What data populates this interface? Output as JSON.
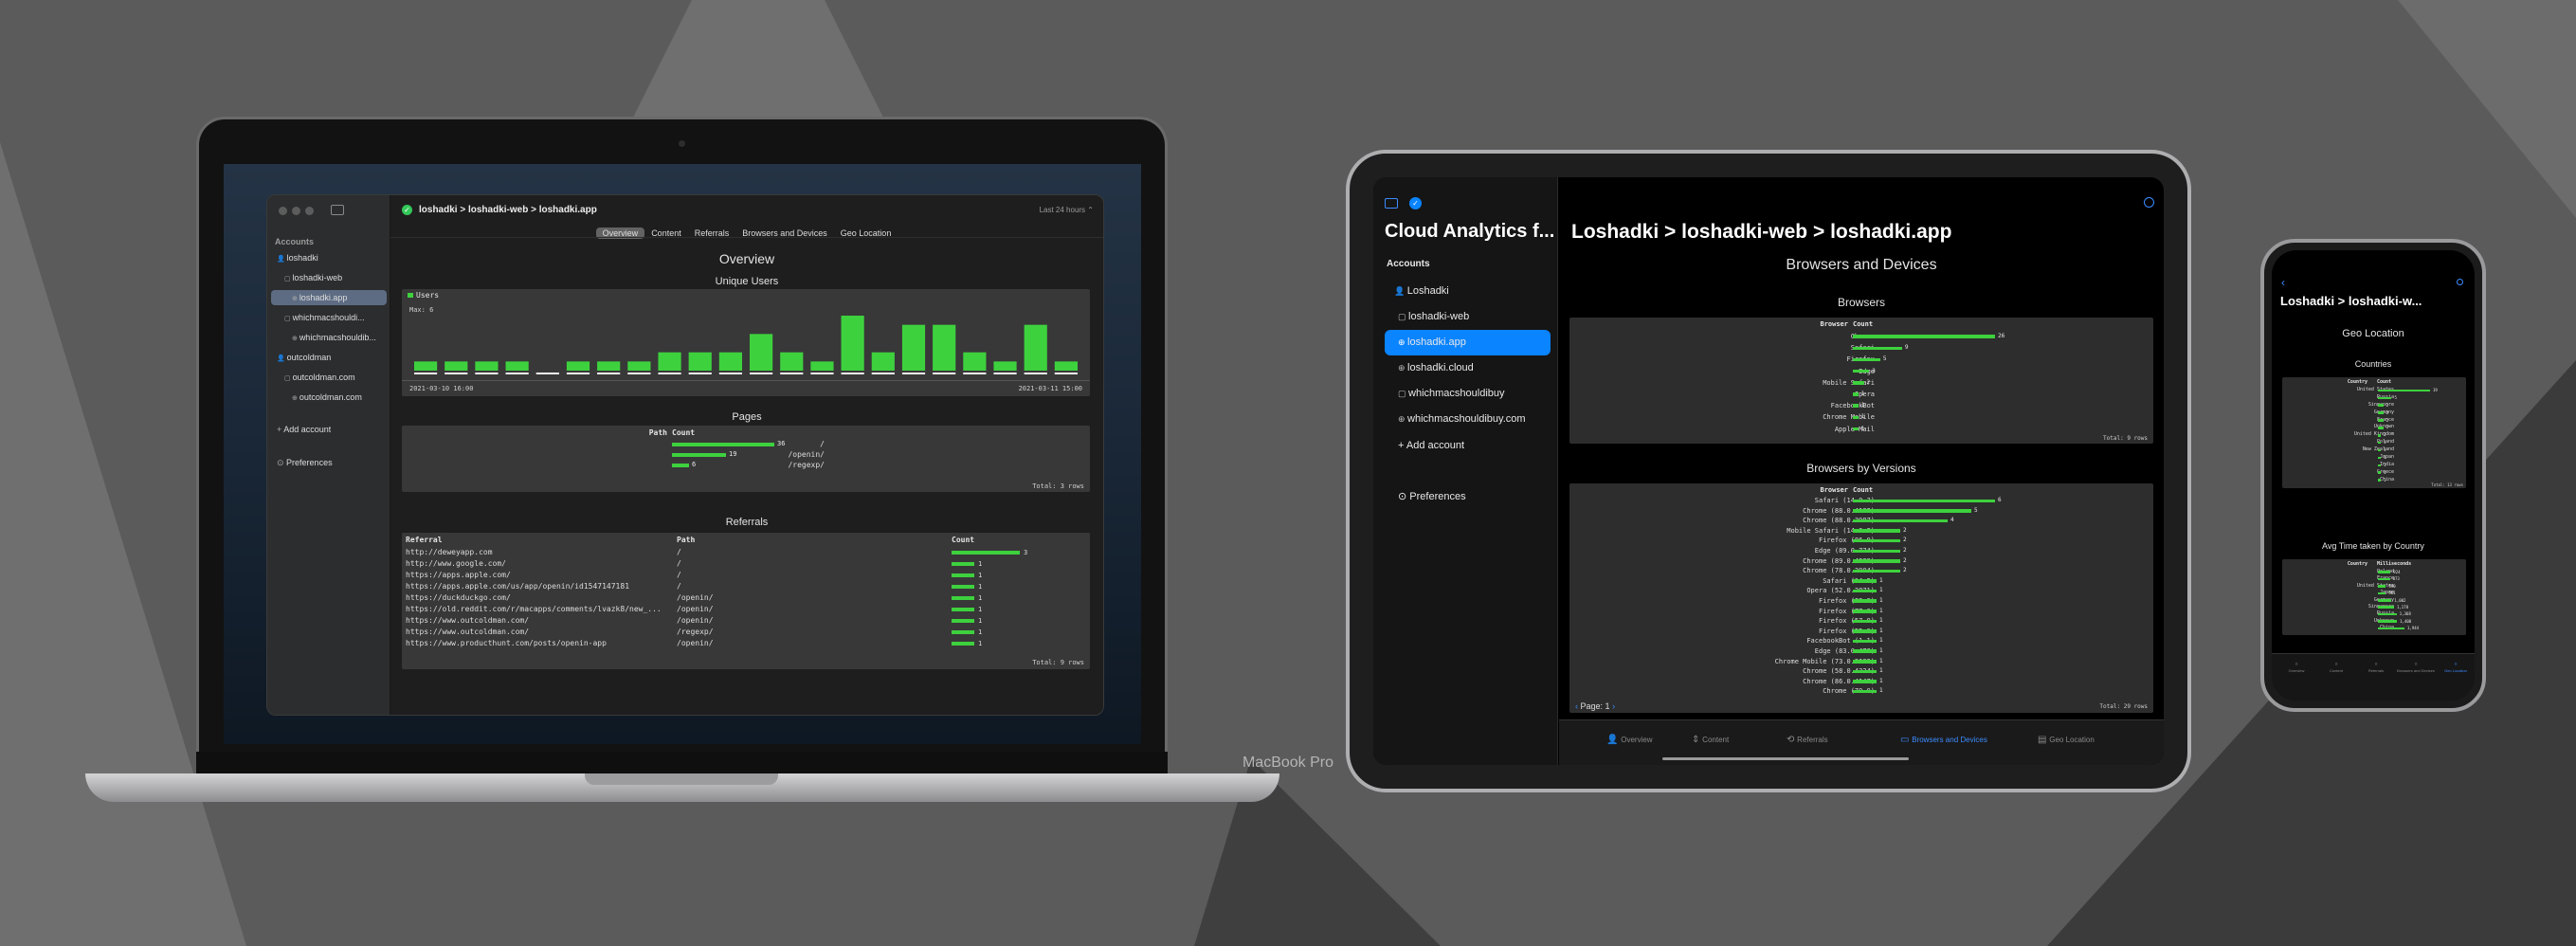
{
  "background": {
    "color": "#5b5b5b",
    "shape_colors": [
      "#6f6f6f",
      "#474747",
      "#3b3b3b"
    ]
  },
  "macbook": {
    "model_label": "MacBook Pro",
    "sidebar": {
      "section_title": "Accounts",
      "items": [
        {
          "label": "loshadki",
          "icon": "person-icon",
          "level": 0
        },
        {
          "label": "loshadki-web",
          "icon": "folder-icon",
          "level": 1
        },
        {
          "label": "loshadki.app",
          "icon": "globe-icon",
          "level": 2,
          "selected": true
        },
        {
          "label": "whichmacshouldi...",
          "icon": "folder-icon",
          "level": 1
        },
        {
          "label": "whichmacshouldib...",
          "icon": "globe-icon",
          "level": 2
        },
        {
          "label": "outcoldman",
          "icon": "person-icon",
          "level": 0
        },
        {
          "label": "outcoldman.com",
          "icon": "folder-icon",
          "level": 1
        },
        {
          "label": "outcoldman.com",
          "icon": "globe-icon",
          "level": 2
        }
      ],
      "add_account": "Add account",
      "preferences": "Preferences"
    },
    "toolbar": {
      "breadcrumb": "loshadki > loshadki-web > loshadki.app",
      "range": "Last 24 hours"
    },
    "tabs": [
      "Overview",
      "Content",
      "Referrals",
      "Browsers and Devices",
      "Geo Location"
    ],
    "selected_tab": 0,
    "page_title": "Overview",
    "unique_users": {
      "title": "Unique Users",
      "legend": "Users",
      "max_label": "Max: 6",
      "values": [
        1,
        1,
        1,
        1,
        0,
        1,
        1,
        1,
        2,
        2,
        2,
        4,
        2,
        1,
        6,
        2,
        5,
        5,
        2,
        1,
        5,
        1
      ],
      "max": 6,
      "start_label": "2021-03-10 16:00",
      "end_label": "2021-03-11 15:00"
    },
    "pages": {
      "title": "Pages",
      "headers": [
        "Path",
        "Count"
      ],
      "rows": [
        {
          "path": "/",
          "count": 36
        },
        {
          "path": "/openin/",
          "count": 19
        },
        {
          "path": "/regexp/",
          "count": 6
        }
      ],
      "max": 36,
      "total": "Total: 3 rows"
    },
    "referrals": {
      "title": "Referrals",
      "headers": [
        "Referral",
        "Path",
        "Count"
      ],
      "rows": [
        {
          "ref": "http://deweyapp.com",
          "path": "/",
          "count": 3
        },
        {
          "ref": "http://www.google.com/",
          "path": "/",
          "count": 1
        },
        {
          "ref": "https://apps.apple.com/",
          "path": "/",
          "count": 1
        },
        {
          "ref": "https://apps.apple.com/us/app/openin/id1547147181",
          "path": "/",
          "count": 1
        },
        {
          "ref": "https://duckduckgo.com/",
          "path": "/openin/",
          "count": 1
        },
        {
          "ref": "https://old.reddit.com/r/macapps/comments/lvazk8/new_...",
          "path": "/openin/",
          "count": 1
        },
        {
          "ref": "https://www.outcoldman.com/",
          "path": "/openin/",
          "count": 1
        },
        {
          "ref": "https://www.outcoldman.com/",
          "path": "/regexp/",
          "count": 1
        },
        {
          "ref": "https://www.producthunt.com/posts/openin-app",
          "path": "/openin/",
          "count": 1
        }
      ],
      "max": 3,
      "total": "Total: 9 rows"
    }
  },
  "ipad": {
    "app_title": "Cloud Analytics f...",
    "sidebar": {
      "section_title": "Accounts",
      "items": [
        {
          "label": "Loshadki",
          "icon": "person-icon",
          "level": 0
        },
        {
          "label": "loshadki-web",
          "icon": "folder-icon",
          "level": 1
        },
        {
          "label": "loshadki.app",
          "icon": "globe-icon",
          "level": 1,
          "selected": true
        },
        {
          "label": "loshadki.cloud",
          "icon": "globe-icon",
          "level": 1
        },
        {
          "label": "whichmacshouldibuy",
          "icon": "folder-icon",
          "level": 1
        },
        {
          "label": "whichmacshouldibuy.com",
          "icon": "globe-icon",
          "level": 1
        }
      ],
      "add_account": "Add account",
      "preferences": "Preferences"
    },
    "breadcrumb": "Loshadki > loshadki-web > loshadki.app",
    "page_title": "Browsers and Devices",
    "browsers": {
      "title": "Browsers",
      "headers": [
        "Browser",
        "Count"
      ],
      "rows": [
        {
          "name": "Chrome",
          "count": 26
        },
        {
          "name": "Safari",
          "count": 9
        },
        {
          "name": "Firefox",
          "count": 5
        },
        {
          "name": "Edge",
          "count": 3
        },
        {
          "name": "Mobile Safari",
          "count": 2
        },
        {
          "name": "Opera",
          "count": 1
        },
        {
          "name": "FacebookBot",
          "count": 1
        },
        {
          "name": "Chrome Mobile",
          "count": 1
        },
        {
          "name": "Apple Mail",
          "count": 1
        }
      ],
      "max": 26,
      "total": "Total: 9 rows"
    },
    "versions": {
      "title": "Browsers by Versions",
      "headers": [
        "Browser",
        "Count"
      ],
      "rows": [
        {
          "name": "Safari (14.0.3)",
          "count": 6
        },
        {
          "name": "Chrome (88.0.4183)",
          "count": 5
        },
        {
          "name": "Chrome (88.0.3987)",
          "count": 4
        },
        {
          "name": "Mobile Safari (14.0.3)",
          "count": 2
        },
        {
          "name": "Firefox (86.0)",
          "count": 2
        },
        {
          "name": "Edge (89.0.774)",
          "count": 2
        },
        {
          "name": "Chrome (89.0.4389)",
          "count": 2
        },
        {
          "name": "Chrome (78.0.3904)",
          "count": 2
        },
        {
          "name": "Safari (14.2)",
          "count": 1
        },
        {
          "name": "Opera (52.0.2871)",
          "count": 1
        },
        {
          "name": "Firefox (88.0)",
          "count": 1
        },
        {
          "name": "Firefox (77.0)",
          "count": 1
        },
        {
          "name": "Firefox (57.0)",
          "count": 1
        },
        {
          "name": "Firefox (55.0)",
          "count": 1
        },
        {
          "name": "FacebookBot (1.1)",
          "count": 1
        },
        {
          "name": "Edge (83.0.478)",
          "count": 1
        },
        {
          "name": "Chrome Mobile (73.0.3683)",
          "count": 1
        },
        {
          "name": "Chrome (58.0.4324)",
          "count": 1
        },
        {
          "name": "Chrome (86.0.4147)",
          "count": 1
        },
        {
          "name": "Chrome (79.0)",
          "count": 1
        }
      ],
      "max": 6,
      "total": "Total: 29 rows",
      "page": "Page: 1"
    },
    "tabbar": [
      {
        "label": "Overview",
        "icon": "person-icon"
      },
      {
        "label": "Content",
        "icon": "arrows-icon"
      },
      {
        "label": "Referrals",
        "icon": "repeat-icon"
      },
      {
        "label": "Browsers and Devices",
        "icon": "devices-icon",
        "selected": true
      },
      {
        "label": "Geo Location",
        "icon": "map-icon"
      }
    ]
  },
  "iphone": {
    "breadcrumb": "Loshadki > loshadki-w...",
    "page_title": "Geo Location",
    "countries": {
      "title": "Countries",
      "headers": [
        "Country",
        "Count"
      ],
      "rows": [
        {
          "name": "United States",
          "count": 19
        },
        {
          "name": "Russia",
          "count": 5
        },
        {
          "name": "Singapore",
          "count": 2
        },
        {
          "name": "Germany",
          "count": 2
        },
        {
          "name": "France",
          "count": 2
        },
        {
          "name": "Unknown",
          "count": 2
        },
        {
          "name": "United Kingdom",
          "count": 1
        },
        {
          "name": "Poland",
          "count": 1
        },
        {
          "name": "New Zealand",
          "count": 1
        },
        {
          "name": "Japan",
          "count": 1
        },
        {
          "name": "India",
          "count": 1
        },
        {
          "name": "Greece",
          "count": 1
        },
        {
          "name": "China",
          "count": 1
        }
      ],
      "max": 19,
      "total": "Total: 13 rows"
    },
    "avg_time": {
      "title": "Avg Time taken by Country",
      "headers": [
        "Country",
        "Milliseconds"
      ],
      "rows": [
        {
          "name": "Poland",
          "value": 924
        },
        {
          "name": "France",
          "value": 873
        },
        {
          "name": "United States",
          "value": 590
        },
        {
          "name": "Japan",
          "value": 581
        },
        {
          "name": "Germany",
          "value": "1,002"
        },
        {
          "name": "Singapore",
          "value": "1,178"
        },
        {
          "name": "Russia",
          "value": "1,368"
        },
        {
          "name": "Unknown",
          "value": "1,400"
        },
        {
          "name": "China",
          "value": "1,944"
        }
      ],
      "max": 1944
    },
    "tabbar": [
      {
        "label": "Overview"
      },
      {
        "label": "Content"
      },
      {
        "label": "Referrals"
      },
      {
        "label": "Browsers and Devices"
      },
      {
        "label": "Geo Location",
        "selected": true
      }
    ]
  }
}
